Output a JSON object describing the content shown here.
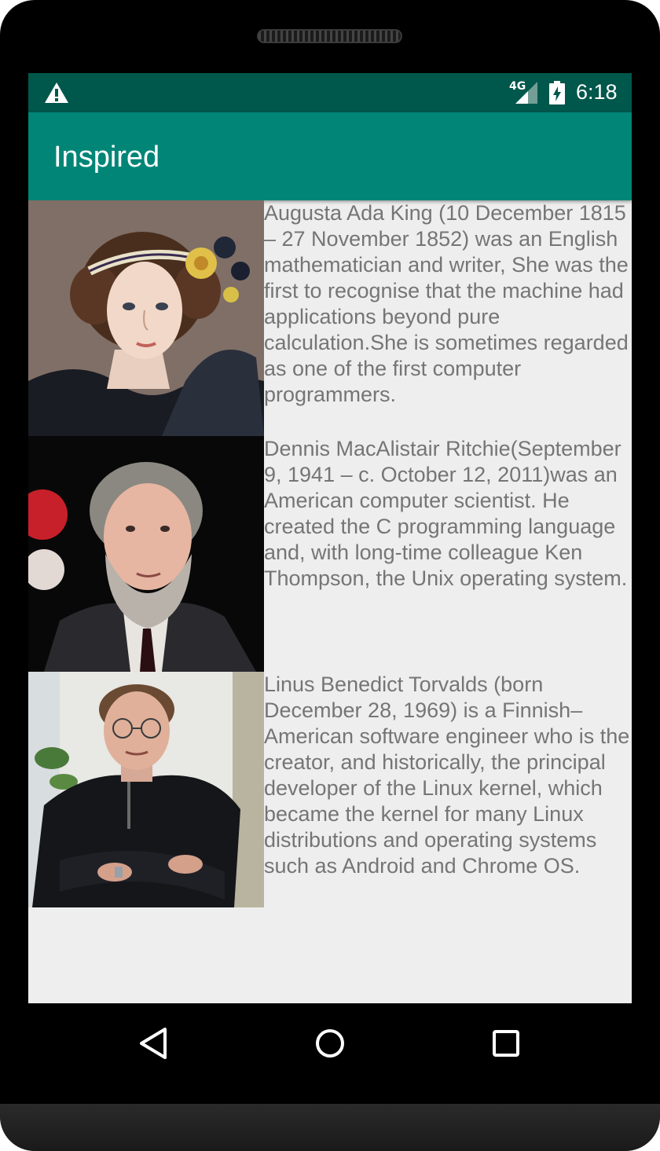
{
  "status_bar": {
    "network": "4G",
    "time": "6:18",
    "icons": [
      "warning-icon",
      "signal-icon",
      "battery-charging-icon"
    ]
  },
  "app_bar": {
    "title": "Inspired",
    "color": "#008577",
    "status_color": "#00574b"
  },
  "people": [
    {
      "photo": "ada-lovelace-portrait",
      "bio": "Augusta Ada King (10 December 1815 – 27 November 1852) was an English mathematician and writer, She was the first to recognise that the machine had applications beyond pure calculation.She is sometimes regarded as one of the first computer programmers."
    },
    {
      "photo": "dennis-ritchie-portrait",
      "bio": "Dennis MacAlistair Ritchie(September 9, 1941 – c. October 12, 2011)was an American computer scientist. He created the C programming language and, with long-time colleague Ken Thompson, the Unix operating system."
    },
    {
      "photo": "linus-torvalds-portrait",
      "bio": "Linus Benedict Torvalds (born December 28, 1969) is a Finnish–American software engineer who is the creator, and historically, the principal developer of the Linux kernel, which became the kernel for many Linux distributions and operating systems such as Android and Chrome OS."
    }
  ],
  "nav": {
    "icons": [
      "back-icon",
      "home-icon",
      "recents-icon"
    ]
  }
}
